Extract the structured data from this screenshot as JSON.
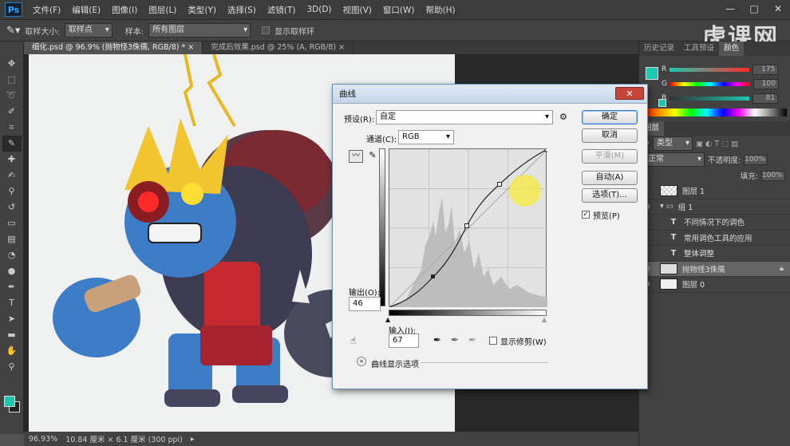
{
  "app": {
    "logo": "Ps",
    "menu": [
      "文件(F)",
      "编辑(E)",
      "图像(I)",
      "图层(L)",
      "类型(Y)",
      "选择(S)",
      "滤镜(T)",
      "3D(D)",
      "视图(V)",
      "窗口(W)",
      "帮助(H)"
    ],
    "window_controls": [
      "—",
      "□",
      "✕"
    ],
    "watermark": "虎课网"
  },
  "options_bar": {
    "sample_size_label": "取样大小:",
    "sample_size_value": "取样点",
    "sample_label": "样本:",
    "sample_value": "所有图层",
    "show_ring_label": "显示取样环"
  },
  "tabs": [
    {
      "label": "细化.psd @ 96.9% (抛物怪3侏儒, RGB/8) * ×"
    },
    {
      "label": "完成后效果.psd @ 25% (A, RGB/8) ×"
    }
  ],
  "status": {
    "zoom": "96.93%",
    "doc_size": "10.84 厘米 × 6.1 厘米 (300 ppi)"
  },
  "right_panel": {
    "top_tabs": [
      "历史记录",
      "工具预设",
      "颜色"
    ],
    "sliders": [
      {
        "label": "R",
        "value": "175"
      },
      {
        "label": "G",
        "value": "100"
      },
      {
        "label": "B",
        "value": "81"
      }
    ],
    "layers_tabs": [
      "图层"
    ],
    "kind_label": "类型",
    "blend_mode": "正常",
    "opacity_label": "不透明度:",
    "opacity_value": "100%",
    "fill_label": "填充:",
    "fill_value": "100%",
    "layers": [
      {
        "name": "图层 1",
        "type": "image"
      },
      {
        "name": "组 1",
        "type": "group"
      },
      {
        "name": "不同情况下的调色",
        "type": "text"
      },
      {
        "name": "常用调色工具的应用",
        "type": "text"
      },
      {
        "name": "整体调整",
        "type": "text"
      },
      {
        "name": "抛物怪3侏儒",
        "type": "image",
        "selected": true
      },
      {
        "name": "图层 0",
        "type": "image"
      }
    ]
  },
  "dialog": {
    "title": "曲线",
    "preset_label": "预设(R):",
    "preset_value": "自定",
    "channel_label": "通道(C):",
    "channel_value": "RGB",
    "buttons": {
      "ok": "确定",
      "cancel": "取消",
      "smooth": "平滑(M)",
      "auto": "自动(A)",
      "options": "选项(T)..."
    },
    "preview_label": "预览(P)",
    "preview_checked": true,
    "output_label": "输出(O):",
    "output_value": "46",
    "input_label": "输入(I):",
    "input_value": "67",
    "show_clipping_label": "显示修剪(W)",
    "curve_display_label": "曲线显示选项"
  },
  "colors": {
    "foreground": "#1cc7b0",
    "background": "#222222"
  }
}
